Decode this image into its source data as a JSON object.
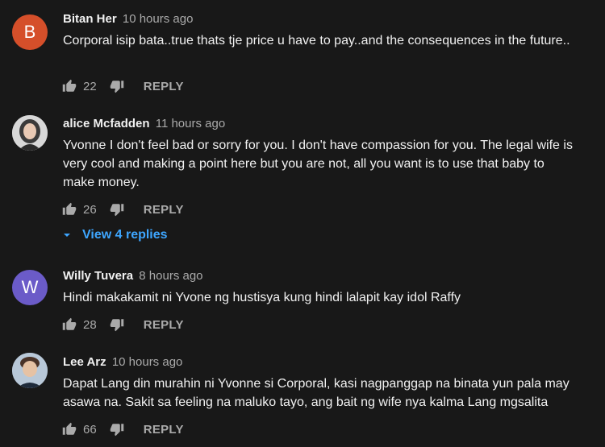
{
  "comments": [
    {
      "avatar_letter": "B",
      "avatar_color": "#d54f2a",
      "author": "Bitan Her",
      "time": "10 hours ago",
      "text": "Corporal isip bata..true thats tje price u have to pay..and the consequences in the future..",
      "likes": "22",
      "reply_label": "REPLY"
    },
    {
      "avatar_letter": "",
      "author": "alice Mcfadden",
      "time": "11 hours ago",
      "text": "Yvonne  I don't feel bad or sorry for you. I don't have compassion for you. The legal wife is very cool and making a point here but you are not, all you want is to use that baby to make money.",
      "likes": "26",
      "reply_label": "REPLY",
      "view_replies": "View 4 replies"
    },
    {
      "avatar_letter": "W",
      "avatar_color": "#6b5bc8",
      "author": "Willy Tuvera",
      "time": "8 hours ago",
      "text": "Hindi makakamit ni Yvone ng hustisya kung hindi lalapit kay idol Raffy",
      "likes": "28",
      "reply_label": "REPLY"
    },
    {
      "avatar_letter": "",
      "author": "Lee Arz",
      "time": "10 hours ago",
      "text": "Dapat Lang din murahin ni Yvonne si Corporal, kasi nagpanggap na binata yun pala may asawa na. Sakit sa feeling na maluko tayo, ang bait ng wife nya kalma Lang mgsalita",
      "likes": "66",
      "reply_label": "REPLY"
    }
  ],
  "colors": {
    "background": "#181818",
    "secondary_text": "#aaaaaa",
    "link_blue": "#3ea6ff"
  },
  "icons": [
    "thumbs-up-icon",
    "thumbs-down-icon",
    "caret-down-icon"
  ]
}
